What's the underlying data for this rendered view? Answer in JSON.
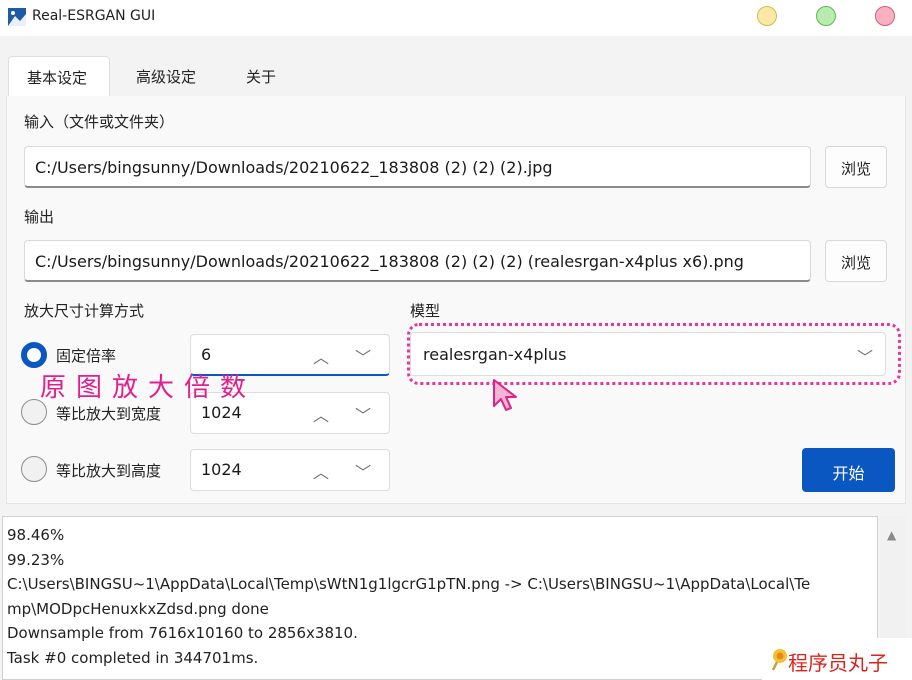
{
  "window": {
    "title": "Real-ESRGAN GUI"
  },
  "tabs": [
    {
      "label": "基本设定"
    },
    {
      "label": "高级设定"
    },
    {
      "label": "关于"
    }
  ],
  "input": {
    "label": "输入（文件或文件夹）",
    "value": "C:/Users/bingsunny/Downloads/20210622_183808 (2) (2) (2).jpg",
    "browse_label": "浏览"
  },
  "output": {
    "label": "输出",
    "value": "C:/Users/bingsunny/Downloads/20210622_183808 (2) (2) (2) (realesrgan-x4plus x6).png",
    "browse_label": "浏览"
  },
  "scale": {
    "label": "放大尺寸计算方式",
    "options": [
      {
        "label": "固定倍率",
        "value": "6",
        "checked": true
      },
      {
        "label": "等比放大到宽度",
        "value": "1024",
        "checked": false
      },
      {
        "label": "等比放大到高度",
        "value": "1024",
        "checked": false
      }
    ],
    "up_glyph": "︿",
    "down_glyph": "﹀"
  },
  "model": {
    "label": "模型",
    "value": "realesrgan-x4plus",
    "chevron": "﹀"
  },
  "annotation": "原图放大倍数",
  "start_label": "开始",
  "log": {
    "lines": [
      "98.46%",
      "99.23%",
      "C:\\Users\\BINGSU~1\\AppData\\Local\\Temp\\sWtN1g1lgcrG1pTN.png -> C:\\Users\\BINGSU~1\\AppData\\Local\\Te",
      "mp\\MODpcHenuxkxZdsd.png done",
      "Downsample from 7616x10160 to 2856x3810.",
      "Task #0 completed in 344701ms."
    ],
    "scroll_up": "▲"
  },
  "watermark": {
    "text": "程序员丸子"
  },
  "colors": {
    "accent": "#0b57c1",
    "annotation": "#e0208e",
    "watermark": "#d9251c"
  }
}
